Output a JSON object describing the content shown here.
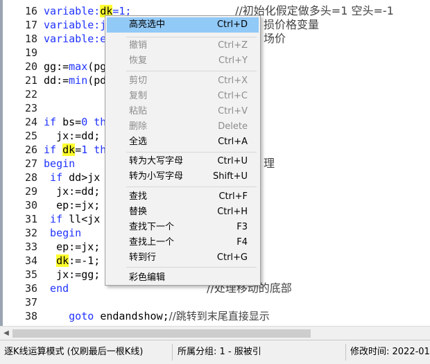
{
  "editor": {
    "lines": [
      {
        "num": "16",
        "parts": [
          {
            "t": "variable:",
            "c": "kw"
          },
          {
            "t": "dk",
            "c": "hl"
          },
          {
            "t": "=1;",
            "c": "kw"
          }
        ]
      },
      {
        "num": "17",
        "parts": [
          {
            "t": "variable:j",
            "c": "kw"
          }
        ]
      },
      {
        "num": "18",
        "parts": [
          {
            "t": "variable:e",
            "c": "kw"
          }
        ]
      },
      {
        "num": "19",
        "parts": []
      },
      {
        "num": "20",
        "parts": [
          {
            "t": "gg:=",
            "c": ""
          },
          {
            "t": "max",
            "c": "kw"
          },
          {
            "t": "(pg",
            "c": ""
          }
        ]
      },
      {
        "num": "21",
        "parts": [
          {
            "t": "dd:=",
            "c": ""
          },
          {
            "t": "min",
            "c": "kw"
          },
          {
            "t": "(pd",
            "c": ""
          }
        ]
      },
      {
        "num": "22",
        "parts": []
      },
      {
        "num": "23",
        "parts": []
      },
      {
        "num": "24",
        "parts": [
          {
            "t": "if ",
            "c": "kw"
          },
          {
            "t": "bs=",
            "c": ""
          },
          {
            "t": "0 th",
            "c": "kw"
          }
        ]
      },
      {
        "num": "25",
        "parts": [
          {
            "t": "  jx:=dd;",
            "c": ""
          }
        ]
      },
      {
        "num": "26",
        "parts": [
          {
            "t": "if ",
            "c": "kw"
          },
          {
            "t": "dk",
            "c": "hl"
          },
          {
            "t": "=",
            "c": ""
          },
          {
            "t": "1 th",
            "c": "kw"
          }
        ]
      },
      {
        "num": "27",
        "parts": [
          {
            "t": "begin",
            "c": "kw"
          }
        ]
      },
      {
        "num": "28",
        "parts": [
          {
            "t": " if ",
            "c": "kw"
          },
          {
            "t": "dd>jx",
            "c": ""
          }
        ]
      },
      {
        "num": "29",
        "parts": [
          {
            "t": "  jx:=dd;",
            "c": ""
          }
        ]
      },
      {
        "num": "30",
        "parts": [
          {
            "t": "  ep:=jx;",
            "c": ""
          }
        ]
      },
      {
        "num": "31",
        "parts": [
          {
            "t": " if ",
            "c": "kw"
          },
          {
            "t": "ll<jx",
            "c": ""
          }
        ]
      },
      {
        "num": "32",
        "parts": [
          {
            "t": " begin",
            "c": "kw"
          }
        ]
      },
      {
        "num": "33",
        "parts": [
          {
            "t": "  ep:=jx;",
            "c": ""
          }
        ]
      },
      {
        "num": "34",
        "parts": [
          {
            "t": "  ",
            "c": ""
          },
          {
            "t": "dk",
            "c": "hl"
          },
          {
            "t": ":=-1;",
            "c": ""
          }
        ]
      },
      {
        "num": "35",
        "parts": [
          {
            "t": "  jx:=gg;",
            "c": ""
          }
        ]
      },
      {
        "num": "36",
        "parts": [
          {
            "t": " end",
            "c": "kw"
          }
        ]
      },
      {
        "num": "37",
        "parts": []
      },
      {
        "num": "38",
        "parts": [
          {
            "t": "    goto ",
            "c": "kw"
          },
          {
            "t": "endandshow;",
            "c": ""
          },
          {
            "t": "//跳转到末尾直接显示",
            "c": "cmt"
          }
        ]
      }
    ],
    "comments": {
      "line16": "//初始化假定做多头=1 空头=-1",
      "line17": "损价格变量",
      "line18": "场价",
      "line27": "理",
      "line36": "//处理移动的底部"
    }
  },
  "context_menu": {
    "items": [
      {
        "label": "高亮选中",
        "shortcut": "Ctrl+D",
        "state": "selected"
      },
      {
        "label": "撤销",
        "shortcut": "Ctrl+Z",
        "state": "disabled"
      },
      {
        "label": "恢复",
        "shortcut": "Ctrl+Y",
        "state": "disabled"
      },
      {
        "label": "剪切",
        "shortcut": "Ctrl+X",
        "state": "disabled"
      },
      {
        "label": "复制",
        "shortcut": "Ctrl+C",
        "state": "disabled"
      },
      {
        "label": "粘贴",
        "shortcut": "Ctrl+V",
        "state": "disabled"
      },
      {
        "label": "删除",
        "shortcut": "Delete",
        "state": "disabled"
      },
      {
        "label": "全选",
        "shortcut": "Ctrl+A",
        "state": "enabled"
      },
      {
        "label": "转为大写字母",
        "shortcut": "Ctrl+U",
        "state": "enabled"
      },
      {
        "label": "转为小写字母",
        "shortcut": "Shift+U",
        "state": "enabled"
      },
      {
        "label": "查找",
        "shortcut": "Ctrl+F",
        "state": "enabled"
      },
      {
        "label": "替换",
        "shortcut": "Ctrl+H",
        "state": "enabled"
      },
      {
        "label": "查找下一个",
        "shortcut": "F3",
        "state": "enabled"
      },
      {
        "label": "查找上一个",
        "shortcut": "F4",
        "state": "enabled"
      },
      {
        "label": "转到行",
        "shortcut": "Ctrl+G",
        "state": "enabled"
      },
      {
        "label": "彩色编辑",
        "shortcut": "",
        "state": "enabled"
      }
    ]
  },
  "status_bar": {
    "mode": "逐K线运算模式 (仅刷最后一根K线)",
    "group": "所属分组: 1 - 服被引",
    "modified": "修改时间: 2022-01"
  },
  "colors": {
    "keyword": "#1f32ff",
    "highlight": "#ffff2e",
    "menu_selected": "#91c9f7"
  }
}
